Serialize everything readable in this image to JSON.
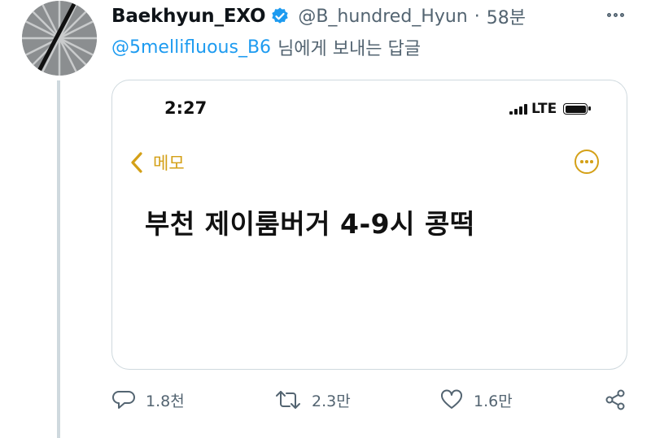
{
  "tweet": {
    "display_name": "Baekhyun_EXO",
    "handle": "@B_hundred_Hyun",
    "separator": "·",
    "time": "58분",
    "reply_to_mention": "@5mellifluous_B6",
    "reply_to_suffix": "님에게 보내는 답글"
  },
  "phone": {
    "time": "2:27",
    "network": "LTE",
    "back_label": "메모",
    "note_text": "부천 제이룸버거 4-9시 콩떡"
  },
  "actions": {
    "reply_count": "1.8천",
    "retweet_count": "2.3만",
    "like_count": "1.6만"
  },
  "colors": {
    "link": "#1d9bf0",
    "muted": "#536471",
    "memo_accent": "#d4a017",
    "border": "#cfd9de"
  },
  "icons": [
    "verified-badge-icon",
    "more-options-icon",
    "signal-icon",
    "battery-icon",
    "chevron-left-icon",
    "ellipsis-circle-icon",
    "reply-icon",
    "retweet-icon",
    "like-icon",
    "share-icon"
  ]
}
